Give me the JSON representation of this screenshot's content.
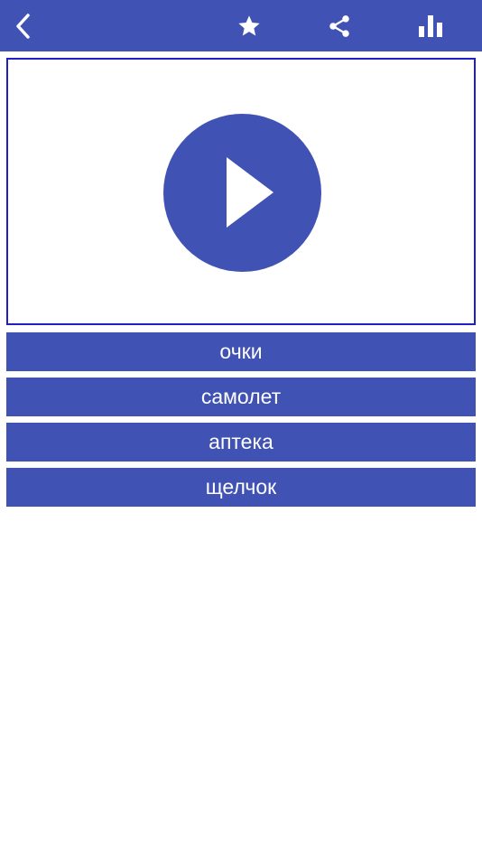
{
  "theme": {
    "primary_color": "#4152b5",
    "border_color": "#1f1fc8",
    "background": "#ffffff"
  },
  "toolbar": {
    "icons": [
      "chevron-left-icon",
      "star-icon",
      "share-icon",
      "bar-chart-icon"
    ]
  },
  "player": {
    "icon": "play-icon"
  },
  "answers": [
    {
      "label": "очки"
    },
    {
      "label": "самолет"
    },
    {
      "label": "аптека"
    },
    {
      "label": "щелчок"
    }
  ]
}
